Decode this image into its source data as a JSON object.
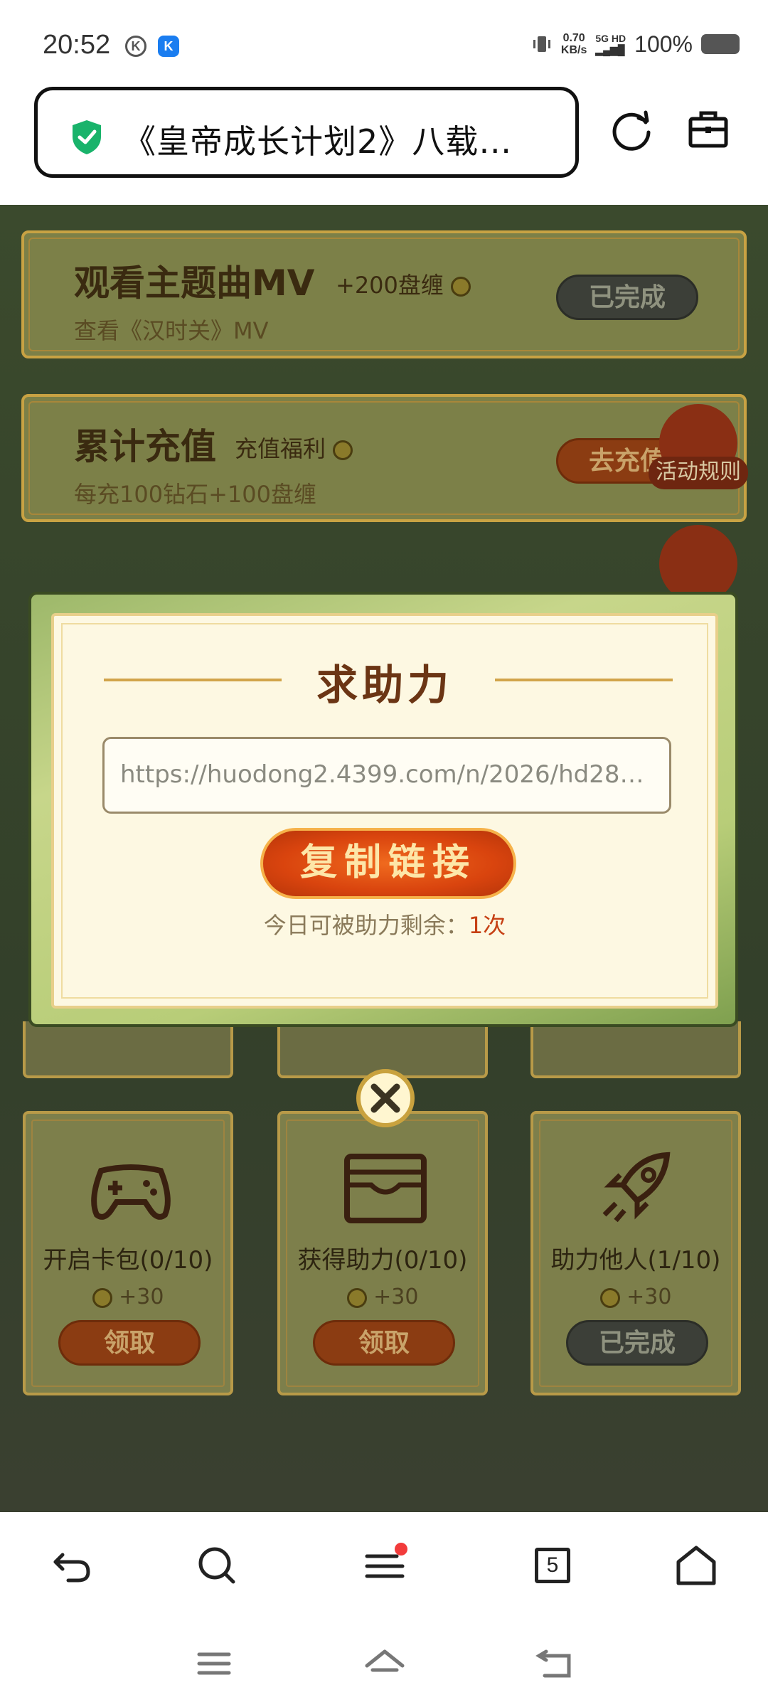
{
  "status_bar": {
    "time": "20:52",
    "speed_top": "0.70",
    "speed_bottom": "KB/s",
    "network": "5G HD",
    "battery": "100%"
  },
  "address_bar": {
    "title": "《皇帝成长计划2》八载…"
  },
  "tasks": [
    {
      "title": "观看主题曲MV",
      "reward": "+200盘缠",
      "desc": "查看《汉时关》MV",
      "button": "已完成"
    },
    {
      "title": "累计充值",
      "reward": "充值福利",
      "desc": "每充100钻石+100盘缠",
      "button": "去充值"
    }
  ],
  "side": {
    "rules_label": "活动规则",
    "share_label": ""
  },
  "grid_tasks": [
    {
      "label": "开启卡包(0/10)",
      "reward": "+30",
      "button": "领取",
      "icon": "gamepad-icon"
    },
    {
      "label": "获得助力(0/10)",
      "reward": "+30",
      "button": "领取",
      "icon": "wallet-icon"
    },
    {
      "label": "助力他人(1/10)",
      "reward": "+30",
      "button": "已完成",
      "icon": "rocket-icon"
    }
  ],
  "modal": {
    "title": "求助力",
    "link": "https://huodong2.4399.com/n/2026/hd28z…",
    "copy_button": "复制链接",
    "remain_label": "今日可被助力剩余：",
    "remain_value": "1次"
  },
  "browser_nav": {
    "tabs_count": "5"
  },
  "colors": {
    "accent_red": "#c64014",
    "shield_green": "#19b36b",
    "page_bg": "#2f3a25"
  }
}
